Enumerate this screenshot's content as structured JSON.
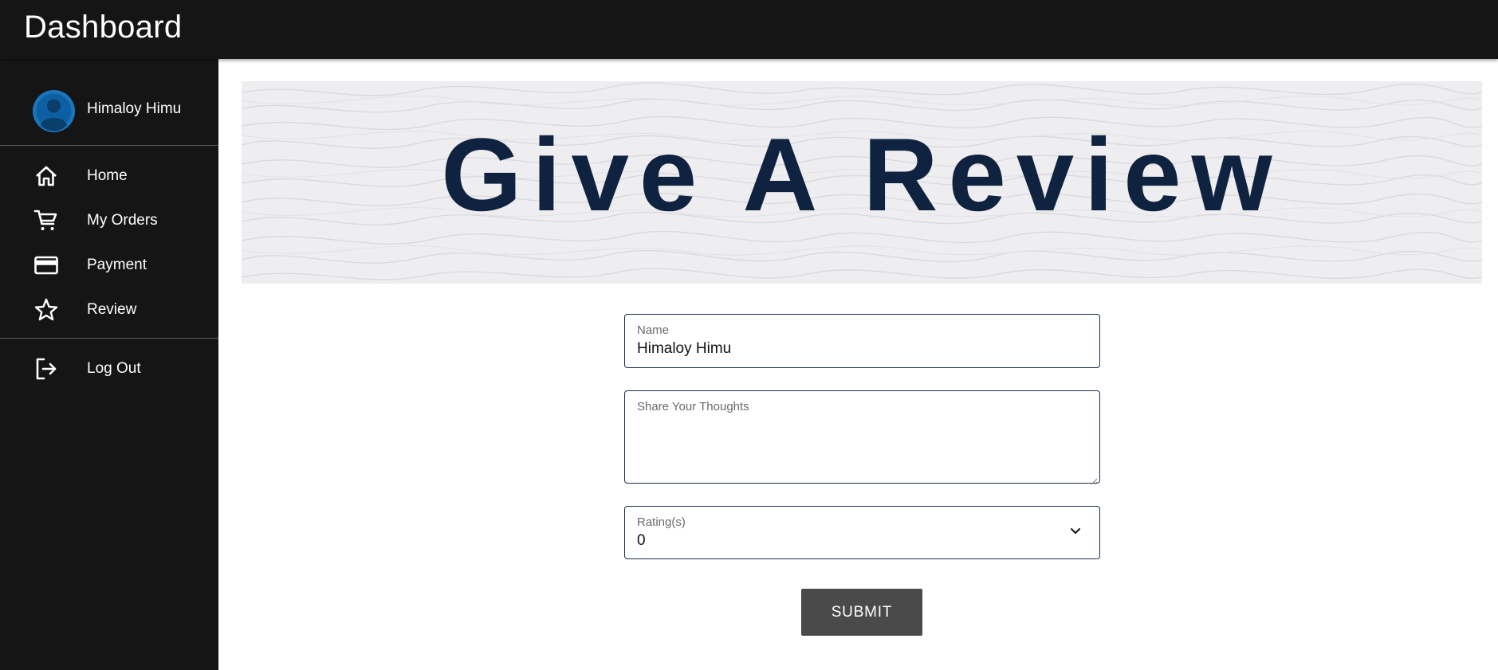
{
  "header": {
    "title": "Dashboard"
  },
  "sidebar": {
    "user": {
      "name": "Himaloy Himu",
      "avatar_icon": "user-avatar-icon"
    },
    "items": [
      {
        "label": "Home",
        "icon": "home-icon"
      },
      {
        "label": "My Orders",
        "icon": "cart-icon"
      },
      {
        "label": "Payment",
        "icon": "credit-card-icon"
      },
      {
        "label": "Review",
        "icon": "star-icon"
      }
    ],
    "logout": {
      "label": "Log Out",
      "icon": "logout-icon"
    }
  },
  "banner": {
    "title": "Give A Review"
  },
  "form": {
    "name": {
      "label": "Name",
      "value": "Himaloy Himu"
    },
    "thoughts": {
      "label": "Share Your Thoughts",
      "value": ""
    },
    "rating": {
      "label": "Rating(s)",
      "value": "0"
    },
    "submit_label": "SUBMIT"
  },
  "colors": {
    "topbar_bg": "#151515",
    "sidebar_bg": "#151515",
    "banner_bg": "#eeeef0",
    "banner_title": "#0f2240",
    "field_border": "#1e2d4d",
    "submit_bg": "#4a4a4a",
    "avatar_bg": "#1b75bb"
  }
}
